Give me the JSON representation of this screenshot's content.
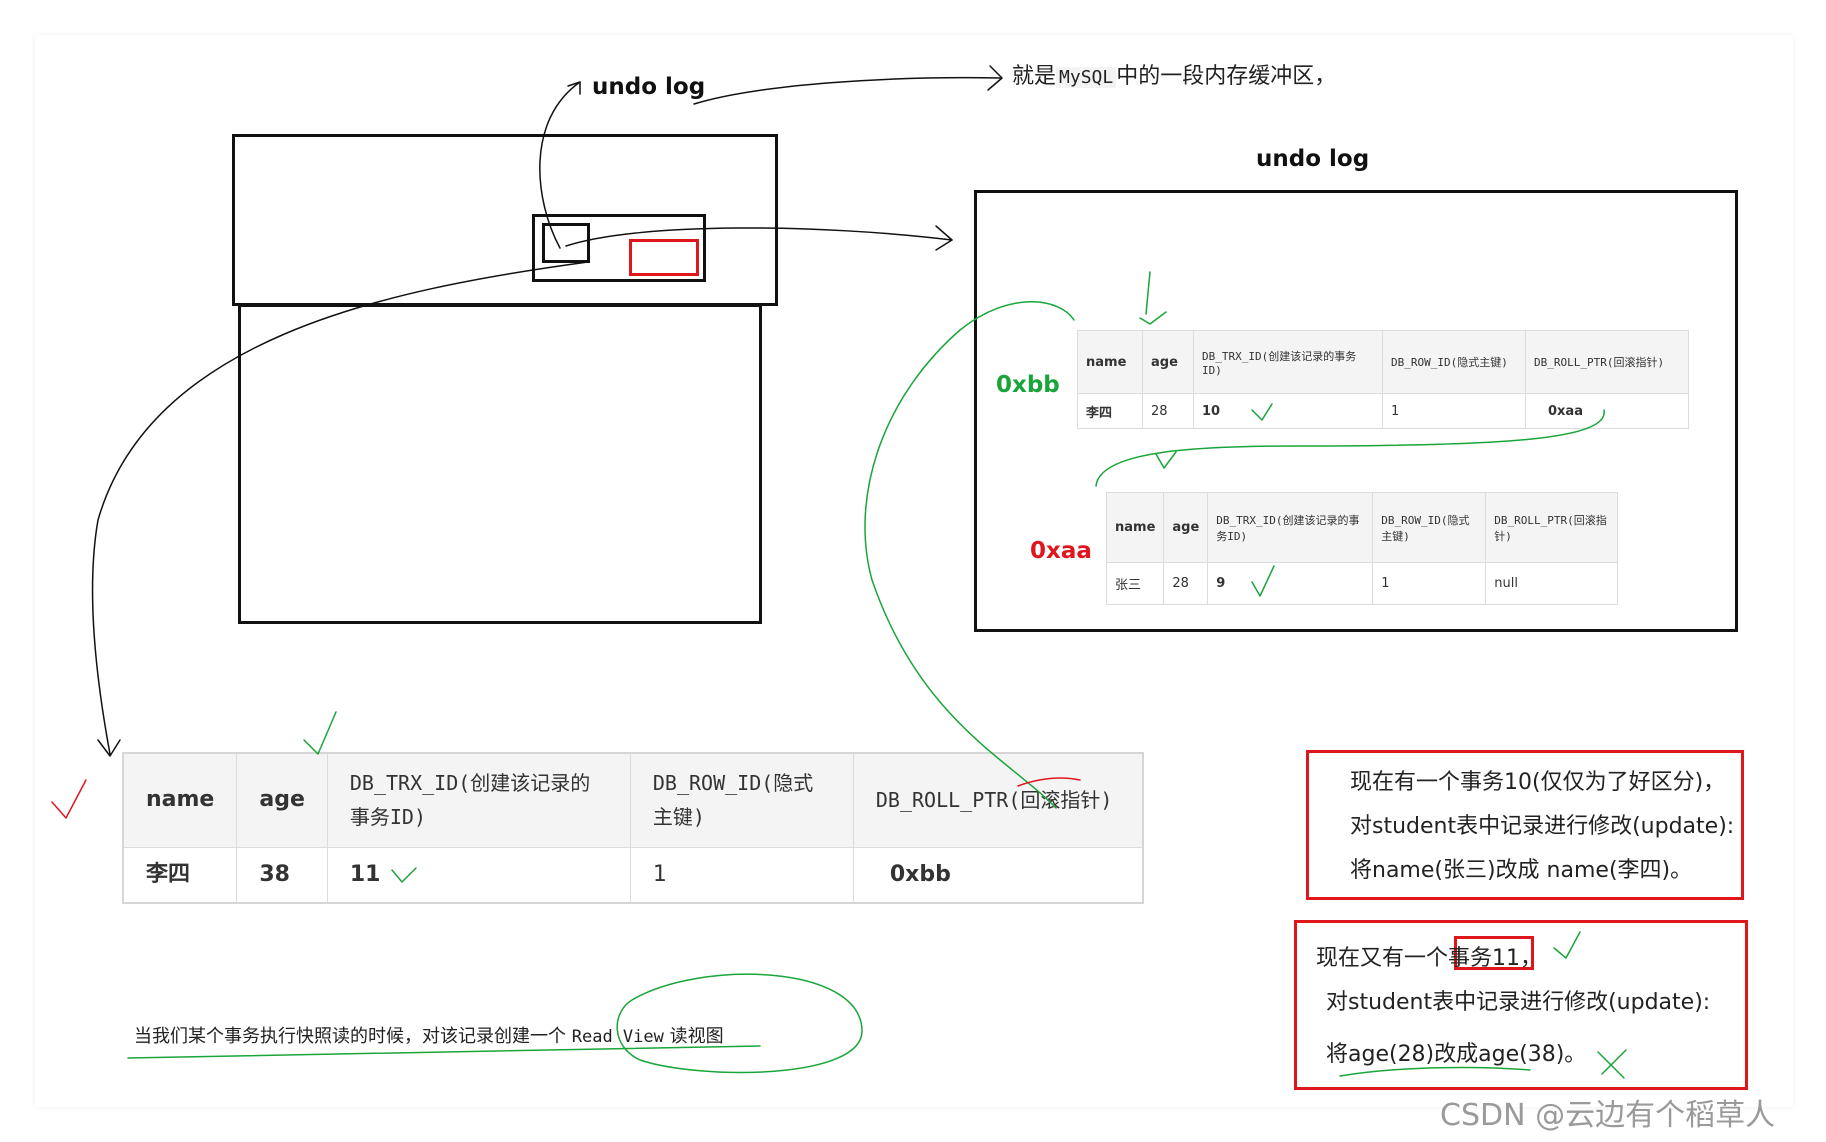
{
  "top_label": "undo log",
  "top_note": {
    "prefix": "就是",
    "code": "MySQL",
    "suffix": "中的一段内存缓冲区，"
  },
  "undo_log_title": "undo log",
  "addr_bb": "0xbb",
  "addr_aa": "0xaa",
  "headers": {
    "name": "name",
    "age": "age",
    "trx": "DB_TRX_ID(创建该记录的事务ID)",
    "row": "DB_ROW_ID(隐式主键)",
    "roll": "DB_ROLL_PTR(回滚指针)"
  },
  "undo_row_1": {
    "name": "李四",
    "age": "28",
    "trx": "10",
    "row": "1",
    "roll": "0xaa"
  },
  "undo_row_2": {
    "name": "张三",
    "age": "28",
    "trx": "9",
    "row": "1",
    "roll": "null"
  },
  "main_row": {
    "name": "李四",
    "age": "38",
    "trx": "11",
    "row": "1",
    "roll": "0xbb"
  },
  "txn10": {
    "line1": "现在有一个事务10(仅仅为了好区分)，",
    "line2": "对student表中记录进行修改(update):",
    "line3": "将name(张三)改成  name(李四)。"
  },
  "txn11": {
    "line1": "现在又有一个事务11，",
    "line2": "对student表中记录进行修改(update):",
    "line3": "将age(28)改成age(38)。"
  },
  "caption": {
    "text": "当我们某个事务执行快照读的时候，对该记录创建一个",
    "code": "Read View",
    "suffix": "读视图"
  },
  "watermark": "CSDN @云边有个稻草人",
  "colors": {
    "red": "#e0161d",
    "green": "#1aa53a",
    "ink": "#111111"
  }
}
